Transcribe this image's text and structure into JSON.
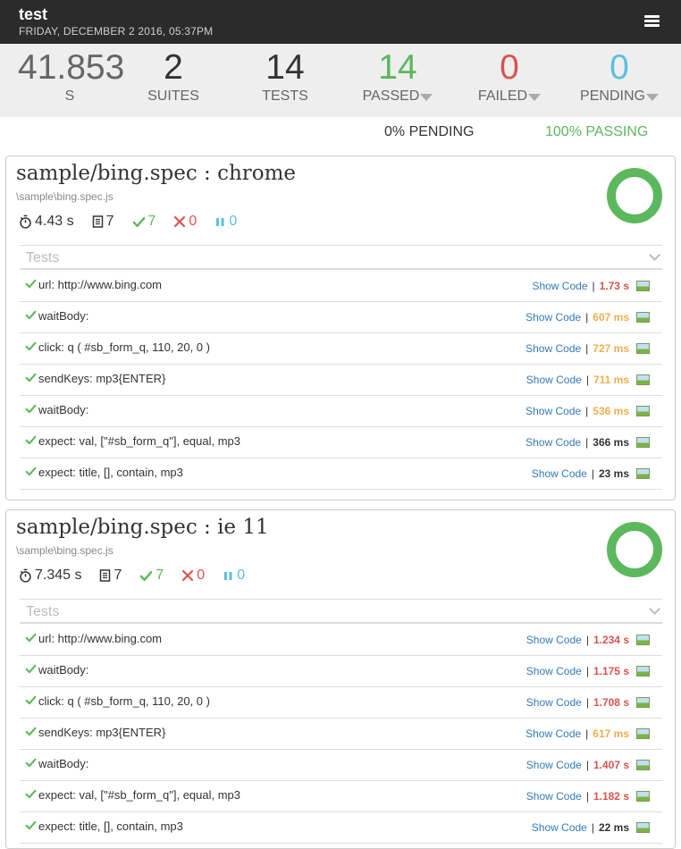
{
  "header": {
    "title": "test",
    "date": "FRIDAY, DECEMBER 2 2016, 05:37PM"
  },
  "summary": {
    "duration_value": "41.853",
    "duration_label": "S",
    "suites_value": "2",
    "suites_label": "SUITES",
    "tests_value": "14",
    "tests_label": "TESTS",
    "passed_value": "14",
    "passed_label": "PASSED",
    "failed_value": "0",
    "failed_label": "FAILED",
    "pending_value": "0",
    "pending_label": "PENDING",
    "pending_pct": "0% PENDING",
    "passing_pct": "100% PASSING"
  },
  "colors": {
    "passed": "#5cb85c",
    "failed": "#d9534f",
    "pending": "#5bc0de",
    "link": "#337ab7"
  },
  "suites": [
    {
      "name": "sample/bing.spec : chrome",
      "path": "\\sample\\bing.spec.js",
      "duration": "4.43 s",
      "tests": "7",
      "passed": "7",
      "failed": "0",
      "pending": "0",
      "pass_fraction": 1.0,
      "tests_header": "Tests",
      "rows": [
        {
          "name": "url: http://www.bing.com",
          "show": "Show Code",
          "dur": "1.73 s",
          "speed": "slow"
        },
        {
          "name": "waitBody:",
          "show": "Show Code",
          "dur": "607 ms",
          "speed": "med"
        },
        {
          "name": "click: q ( #sb_form_q, 110, 20, 0 )",
          "show": "Show Code",
          "dur": "727 ms",
          "speed": "med"
        },
        {
          "name": "sendKeys: mp3{ENTER}",
          "show": "Show Code",
          "dur": "711 ms",
          "speed": "med"
        },
        {
          "name": "waitBody:",
          "show": "Show Code",
          "dur": "536 ms",
          "speed": "med"
        },
        {
          "name": "expect: val, [\"#sb_form_q\"], equal, mp3",
          "show": "Show Code",
          "dur": "366 ms",
          "speed": "fast"
        },
        {
          "name": "expect: title, [], contain, mp3",
          "show": "Show Code",
          "dur": "23 ms",
          "speed": "fast"
        }
      ]
    },
    {
      "name": "sample/bing.spec : ie 11",
      "path": "\\sample\\bing.spec.js",
      "duration": "7.345 s",
      "tests": "7",
      "passed": "7",
      "failed": "0",
      "pending": "0",
      "pass_fraction": 1.0,
      "tests_header": "Tests",
      "rows": [
        {
          "name": "url: http://www.bing.com",
          "show": "Show Code",
          "dur": "1.234 s",
          "speed": "slow"
        },
        {
          "name": "waitBody:",
          "show": "Show Code",
          "dur": "1.175 s",
          "speed": "slow"
        },
        {
          "name": "click: q ( #sb_form_q, 110, 20, 0 )",
          "show": "Show Code",
          "dur": "1.708 s",
          "speed": "slow"
        },
        {
          "name": "sendKeys: mp3{ENTER}",
          "show": "Show Code",
          "dur": "617 ms",
          "speed": "med"
        },
        {
          "name": "waitBody:",
          "show": "Show Code",
          "dur": "1.407 s",
          "speed": "slow"
        },
        {
          "name": "expect: val, [\"#sb_form_q\"], equal, mp3",
          "show": "Show Code",
          "dur": "1.182 s",
          "speed": "slow"
        },
        {
          "name": "expect: title, [], contain, mp3",
          "show": "Show Code",
          "dur": "22 ms",
          "speed": "fast"
        }
      ]
    }
  ]
}
